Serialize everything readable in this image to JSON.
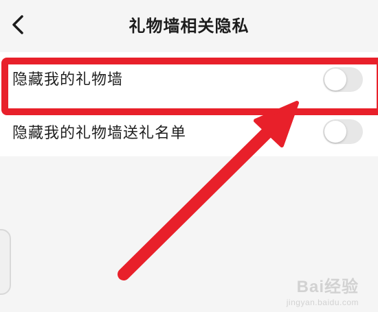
{
  "header": {
    "title": "礼物墙相关隐私",
    "back_icon": "chevron-left-icon"
  },
  "settings": [
    {
      "label": "隐藏我的礼物墙",
      "enabled": false
    },
    {
      "label": "隐藏我的礼物墙送礼名单",
      "enabled": false
    }
  ],
  "annotation": {
    "color": "#e8202a",
    "arrow_icon": "arrow-icon"
  },
  "watermark": {
    "logo": "Bai经验",
    "url": "jingyan.baidu.com"
  }
}
